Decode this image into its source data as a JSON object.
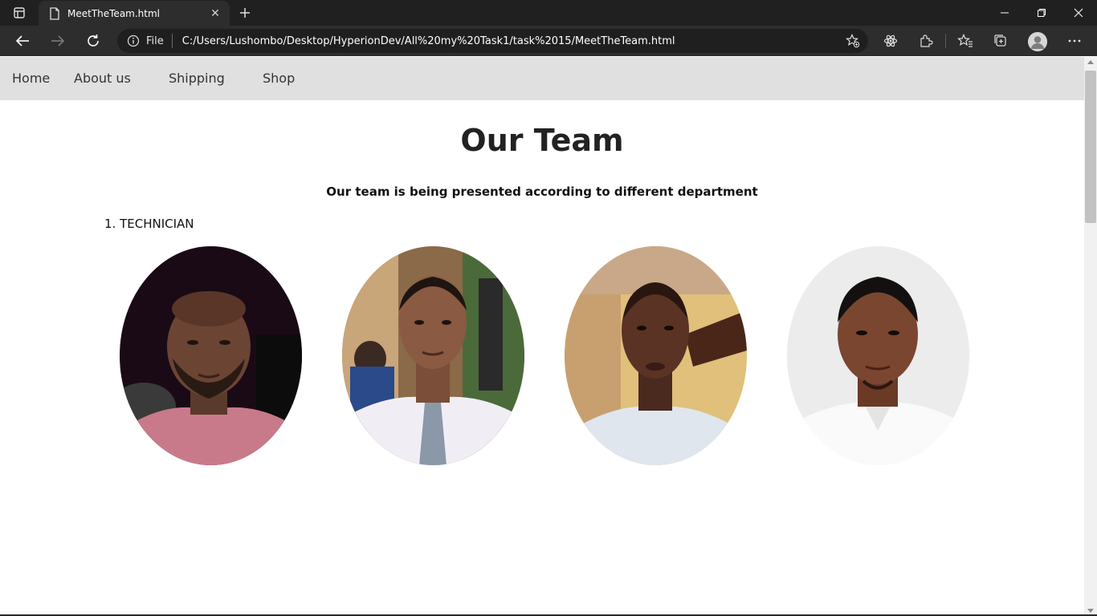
{
  "browser": {
    "tab_title": "MeetTheTeam.html",
    "address_scheme": "File",
    "address_url": "C:/Users/Lushombo/Desktop/HyperionDev/All%20my%20Task1/task%2015/MeetTheTeam.html"
  },
  "nav": {
    "items": [
      {
        "label": "Home"
      },
      {
        "label": "About us"
      },
      {
        "label": "Shipping"
      },
      {
        "label": "Shop"
      }
    ]
  },
  "main": {
    "title": "Our Team",
    "subtitle": "Our team is being presented according to different department",
    "departments": [
      {
        "label": "1. TECHNICIAN"
      }
    ]
  },
  "colors": {
    "tabbar_bg": "#202020",
    "toolbar_bg": "#2d2d2d",
    "navbar_bg": "#e0e0e0"
  }
}
